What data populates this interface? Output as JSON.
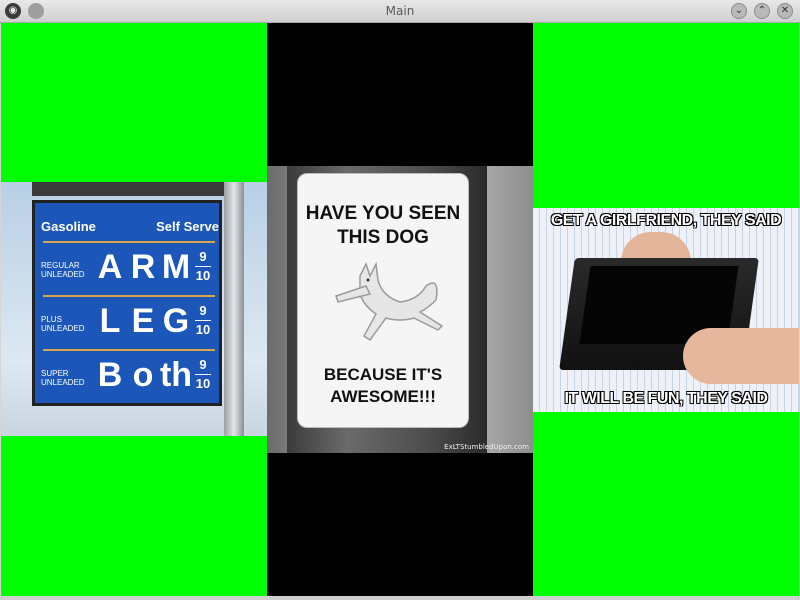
{
  "window": {
    "title": "Main",
    "controls": {
      "menu_icon": "app-menu-icon",
      "sticky_icon": "sticky-icon",
      "minimize_icon": "minimize-icon",
      "maximize_icon": "maximize-icon",
      "close_icon": "close-icon"
    }
  },
  "panels": [
    {
      "background": "#00ff00",
      "image": {
        "header_left": "Gasoline",
        "header_right": "Self Serve",
        "rows": [
          {
            "label_line1": "REGULAR",
            "label_line2": "UNLEADED",
            "letters": [
              "A",
              "R",
              "M"
            ],
            "frac_top": "9",
            "frac_bottom": "10"
          },
          {
            "label_line1": "PLUS",
            "label_line2": "UNLEADED",
            "letters": [
              "L",
              "E",
              "G"
            ],
            "frac_top": "9",
            "frac_bottom": "10"
          },
          {
            "label_line1": "SUPER",
            "label_line2": "UNLEADED",
            "letters": [
              "B",
              "o",
              "th"
            ],
            "frac_top": "9",
            "frac_bottom": "10"
          }
        ]
      }
    },
    {
      "background": "#000000",
      "image": {
        "headline_line1": "HAVE YOU SEEN",
        "headline_line2": "THIS DOG",
        "footer_line1": "BECAUSE IT'S",
        "footer_line2": "AWESOME!!!",
        "credit": "ExLTStumbledUpon.com"
      }
    },
    {
      "background": "#00ff00",
      "image": {
        "caption_top": "GET A GIRLFRIEND, THEY SAID",
        "caption_bottom": "IT WILL BE FUN, THEY SAID"
      }
    }
  ]
}
